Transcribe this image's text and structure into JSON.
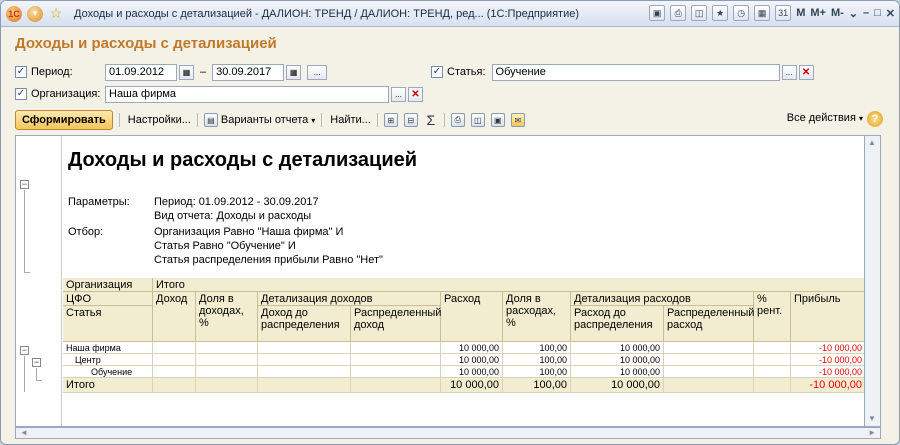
{
  "window": {
    "title": "Доходы и расходы с детализацией - ДАЛИОН: ТРЕНД / ДАЛИОН: ТРЕНД, ред... (1С:Предприятие)",
    "controls": {
      "m": "M",
      "mplus": "M+",
      "mminus": "M-"
    }
  },
  "form": {
    "title": "Доходы и расходы с детализацией",
    "period_label": "Период:",
    "period_from": "01.09.2012",
    "period_dash": "–",
    "period_to": "30.09.2017",
    "period_more": "...",
    "article_label": "Статья:",
    "article_value": "Обучение",
    "org_label": "Организация:",
    "org_value": "Наша фирма",
    "dots": "..."
  },
  "toolbar": {
    "generate": "Сформировать",
    "settings": "Настройки...",
    "variants": "Варианты отчета",
    "find": "Найти...",
    "all_actions": "Все действия",
    "help": "?"
  },
  "report": {
    "title": "Доходы и расходы с детализацией",
    "params_label": "Параметры:",
    "params": [
      "Период: 01.09.2012 - 30.09.2017",
      "Вид отчета: Доходы и расходы"
    ],
    "filter_label": "Отбор:",
    "filters": [
      "Организация Равно \"Наша фирма\" И",
      "Статья Равно \"Обучение\" И",
      "Статья распределения прибыли Равно \"Нет\""
    ],
    "headers": {
      "org": "Организация",
      "cfo": "ЦФО",
      "article": "Статья",
      "total": "Итого",
      "income": "Доход",
      "income_share": "Доля в доходах, %",
      "income_detail": "Детализация доходов",
      "income_before": "Доход до распределения",
      "income_dist": "Распределенный доход",
      "expense": "Расход",
      "expense_share": "Доля в расходах, %",
      "expense_detail": "Детализация расходов",
      "expense_before": "Расход до распределения",
      "expense_dist": "Распределенный расход",
      "rent": "% рент.",
      "profit": "Прибыль"
    },
    "rows": [
      {
        "name": "Наша фирма",
        "expense": "10 000,00",
        "share": "100,00",
        "before": "10 000,00",
        "profit": "-10 000,00"
      },
      {
        "name": "Центр",
        "expense": "10 000,00",
        "share": "100,00",
        "before": "10 000,00",
        "profit": "-10 000,00"
      },
      {
        "name": "Обучение",
        "expense": "10 000,00",
        "share": "100,00",
        "before": "10 000,00",
        "profit": "-10 000,00"
      }
    ],
    "total": {
      "name": "Итого",
      "expense": "10 000,00",
      "share": "100,00",
      "before": "10 000,00",
      "profit": "-10 000,00"
    }
  }
}
